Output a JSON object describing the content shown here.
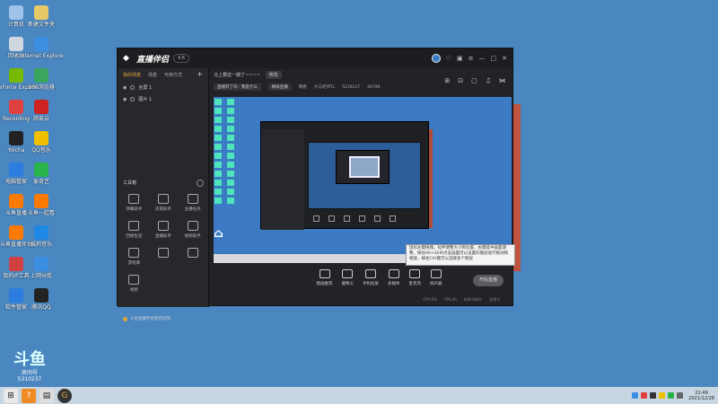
{
  "desktop": {
    "icons": [
      {
        "label": "计算机",
        "color": "#9fc3e8"
      },
      {
        "label": "新建文件夹",
        "color": "#e8c96a"
      },
      {
        "label": "回收站",
        "color": "#cfd8e0"
      },
      {
        "label": "Internet Explorer",
        "color": "#3c8fe0"
      },
      {
        "label": "GeForce Experience",
        "color": "#76b900"
      },
      {
        "label": "360浏览器",
        "color": "#3aa55d"
      },
      {
        "label": "Recording",
        "color": "#e04040"
      },
      {
        "label": "网易云",
        "color": "#c22"
      },
      {
        "label": "Yolcha",
        "color": "#222"
      },
      {
        "label": "QQ音乐",
        "color": "#f0c000"
      },
      {
        "label": "电脑管家",
        "color": "#2d7de0"
      },
      {
        "label": "爱奇艺",
        "color": "#2ab24b"
      },
      {
        "label": "斗鱼直播",
        "color": "#ff7a00"
      },
      {
        "label": "斗鱼一起看",
        "color": "#ff7a00"
      },
      {
        "label": "斗鱼直播伴侣",
        "color": "#ff7a00"
      },
      {
        "label": "酷狗音乐",
        "color": "#1e88e5"
      },
      {
        "label": "我的IP工具",
        "color": "#d04040"
      },
      {
        "label": "上网导航",
        "color": "#3c8fe0"
      },
      {
        "label": "软件管家",
        "color": "#2d7de0"
      },
      {
        "label": "腾讯QQ",
        "color": "#222"
      }
    ],
    "watermark": {
      "logo": "斗鱼",
      "line1": "房间号",
      "line2": "5310237"
    }
  },
  "app": {
    "brand": "直播伴侣",
    "version": "4.6",
    "left_tabs": [
      "我的场景",
      "场景",
      "可换方式"
    ],
    "sources": [
      "全屏 1",
      "图片 1"
    ],
    "tools_header": "工具箱",
    "tools": [
      "弹幕助手",
      "房管助手",
      "主播任务",
      "回顾生涯",
      "直播助手",
      "视频助手",
      "游戏库",
      "",
      "",
      "视频"
    ],
    "notice": "斗鱼直播伴侣使用说明",
    "room_title": "马上要这一期了~~~~",
    "edit_btn": "修改",
    "row2": {
      "category": "直播开了吗 · 我是什么",
      "mode": "横屏直播",
      "mode2": "网络",
      "fans": "大马老师TL",
      "date": "5210237",
      "viewers": "46796"
    },
    "controls": [
      "图画推荐",
      "摄像头",
      "手机投屏",
      "多媒体",
      "麦克风",
      "扬声器"
    ],
    "golive": "开始直播",
    "stats": [
      "CPU:2%",
      "FPS:30",
      "码率:0kb/s",
      "丢帧:0"
    ]
  },
  "tooltip": "鼠标左键拖拽，拉伸调整大小和位置，右键选中画面调整，按住Alt+Shift点击画面可以设置的图层进行拖动和缩放，按住Ctrl键可以选择多个图层",
  "taskbar": {
    "time": "21:49",
    "date": "2021/12/28"
  },
  "colors": {
    "desktop": "#4a86c0",
    "accent": "#e0a33c",
    "taskbar": "#c8d6e2"
  }
}
